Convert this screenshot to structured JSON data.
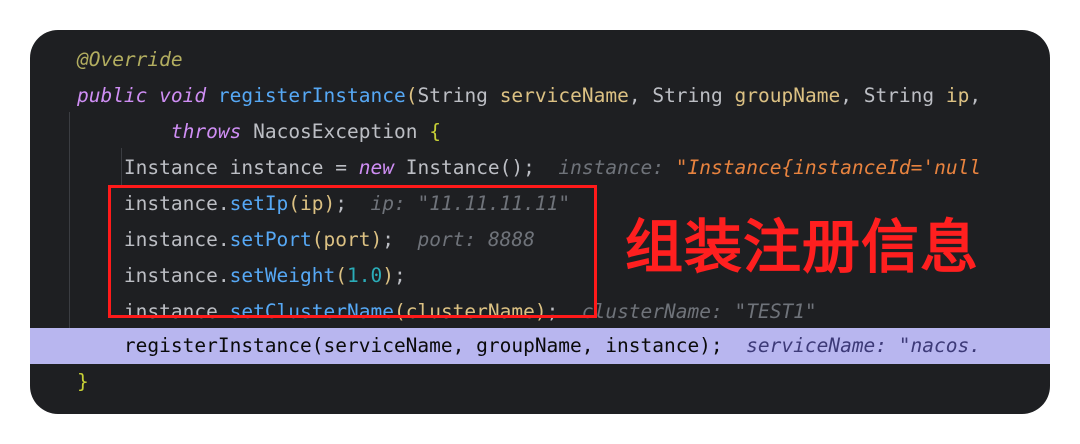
{
  "code": {
    "override_annotation": "@Override",
    "kw_public": "public",
    "kw_void": "void",
    "method_name": "registerInstance",
    "paren_open": "(",
    "type_string": "String",
    "param_service_name": "serviceName",
    "param_group_name": "groupName",
    "param_ip": "ip",
    "comma": ",",
    "kw_throws": "throws",
    "exception_name": "NacosException",
    "brace_open": "{",
    "brace_close": "}",
    "type_instance": "Instance",
    "var_instance": "instance",
    "op_assign": "=",
    "kw_new": "new",
    "ctor_call": "Instance();",
    "hint_instance_label": "instance:",
    "hint_instance_value": "\"Instance{instanceId='null",
    "dot": ".",
    "m_set_ip": "setIp",
    "arg_ip": "ip",
    "hint_ip_label": "ip:",
    "hint_ip_value": "\"11.11.11.11\"",
    "m_set_port": "setPort",
    "arg_port": "port",
    "hint_port_label": "port:",
    "hint_port_value": "8888",
    "m_set_weight": "setWeight",
    "arg_weight": "1.0",
    "m_set_cluster": "setClusterName",
    "arg_cluster": "clusterName",
    "hint_cluster_label": "clusterName:",
    "hint_cluster_value": "\"TEST1\"",
    "call_text": "registerInstance(serviceName, groupName, instance);",
    "hint_service_label": "serviceName:",
    "hint_service_value": "\"nacos.",
    "close_paren_semi": ");",
    "paren_close": ")"
  },
  "annotation": {
    "text": "组装注册信息",
    "color": "#ff1f1f"
  },
  "colors": {
    "editor_bg": "#1e1f22",
    "current_line": "#b8b6ef",
    "keyword": "#cf8ef4",
    "method": "#56a8f5",
    "parameter": "#dcc183",
    "number": "#2aacb8",
    "inlay_hint": "#6f737a",
    "string_hint": "#e8833f"
  }
}
